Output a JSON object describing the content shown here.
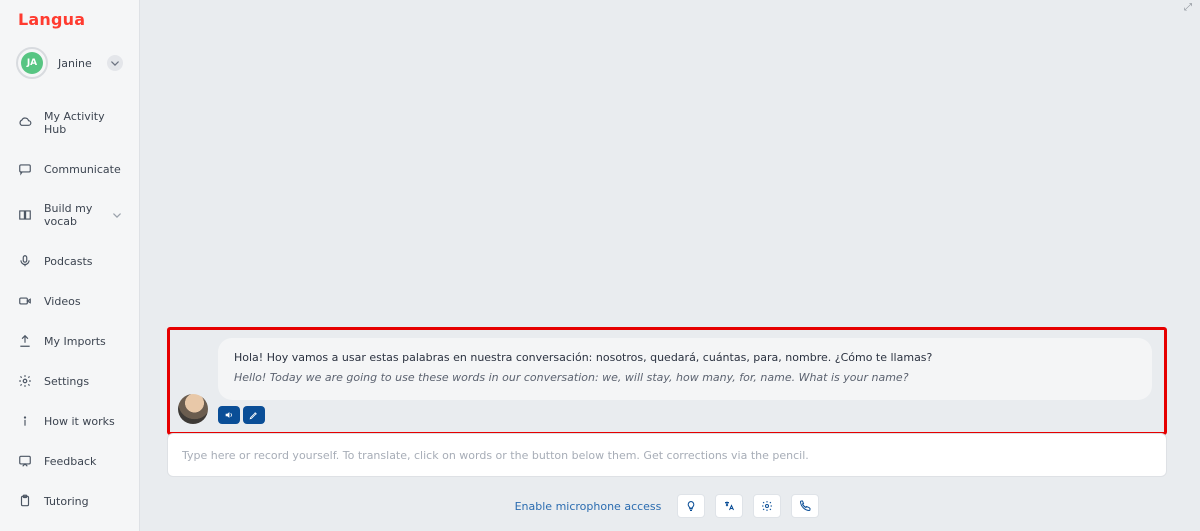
{
  "brand": "Langua",
  "user": {
    "initials": "JA",
    "name": "Janine"
  },
  "sidebar": {
    "items": [
      {
        "id": "activity",
        "label": "My Activity Hub",
        "icon": "cloud"
      },
      {
        "id": "communicate",
        "label": "Communicate",
        "icon": "chat"
      },
      {
        "id": "vocab",
        "label": "Build my vocab",
        "icon": "book",
        "expandable": true
      },
      {
        "id": "podcasts",
        "label": "Podcasts",
        "icon": "mic"
      },
      {
        "id": "videos",
        "label": "Videos",
        "icon": "video"
      },
      {
        "id": "imports",
        "label": "My Imports",
        "icon": "upload"
      },
      {
        "id": "settings",
        "label": "Settings",
        "icon": "gear"
      },
      {
        "id": "how",
        "label": "How it works",
        "icon": "info"
      },
      {
        "id": "feedback",
        "label": "Feedback",
        "icon": "feedback"
      },
      {
        "id": "tutoring",
        "label": "Tutoring",
        "icon": "clipboard"
      }
    ]
  },
  "chat": {
    "message": {
      "native": "Hola! Hoy vamos a usar estas palabras en nuestra conversación: nosotros, quedará, cuántas, para, nombre. ¿Cómo te llamas?",
      "translation": "Hello! Today we are going to use these words in our conversation: we, will stay, how many, for, name. What is your name?"
    },
    "actions": {
      "speak_icon": "volume-icon",
      "more_icon": "pencil-icon"
    }
  },
  "composer": {
    "placeholder": "Type here or record yourself. To translate, click on words or the button below them. Get corrections via the pencil."
  },
  "footer": {
    "mic_link": "Enable microphone access",
    "buttons": [
      {
        "id": "hint",
        "icon": "lightbulb"
      },
      {
        "id": "translate",
        "icon": "translate"
      },
      {
        "id": "settings",
        "icon": "gear"
      },
      {
        "id": "call",
        "icon": "phone"
      }
    ]
  },
  "window": {
    "handle": "⤢"
  },
  "colors": {
    "accent": "#0a4e97",
    "brand": "#ff3b30",
    "highlight": "#e60000",
    "link": "#2b6cb0"
  }
}
